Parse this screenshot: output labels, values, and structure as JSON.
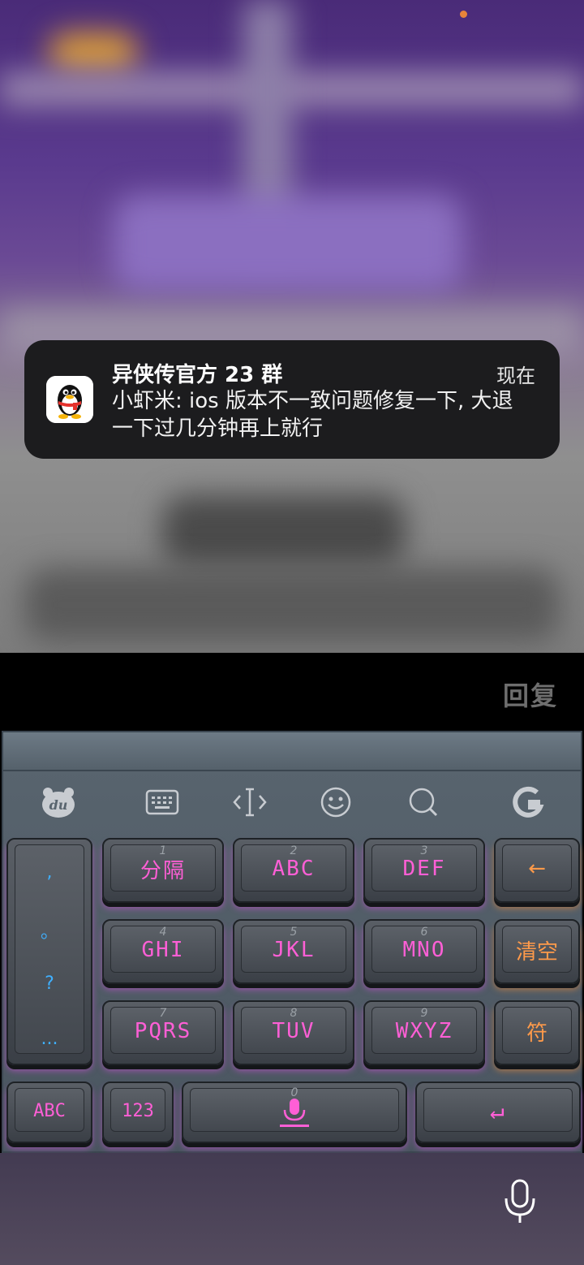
{
  "notification": {
    "title": "异侠传官方 23 群",
    "time": "现在",
    "message": "小虾米: ios 版本不一致问题修复一下, 大退一下过几分钟再上就行",
    "app_icon": "qq-penguin-icon"
  },
  "reply": {
    "label": "回复"
  },
  "toolbar": {
    "items": [
      {
        "name": "du-logo-icon"
      },
      {
        "name": "keyboard-icon"
      },
      {
        "name": "cursor-move-icon"
      },
      {
        "name": "emoji-icon"
      },
      {
        "name": "search-icon"
      },
      {
        "name": "g-logo-icon"
      }
    ]
  },
  "keys": {
    "punctuation": [
      ",",
      "。",
      "?",
      "..."
    ],
    "row1": [
      {
        "num": "1",
        "label": "分隔"
      },
      {
        "num": "2",
        "label": "ABC"
      },
      {
        "num": "3",
        "label": "DEF"
      }
    ],
    "row2": [
      {
        "num": "4",
        "label": "GHI"
      },
      {
        "num": "5",
        "label": "JKL"
      },
      {
        "num": "6",
        "label": "MNO"
      }
    ],
    "row3": [
      {
        "num": "7",
        "label": "PQRS"
      },
      {
        "num": "8",
        "label": "TUV"
      },
      {
        "num": "9",
        "label": "WXYZ"
      }
    ],
    "backspace": "←",
    "clear": "清空",
    "symbols": "符",
    "abc": "ABC",
    "num123": "123",
    "space_num": "0",
    "enter": "↵"
  },
  "colors": {
    "key_label": "#ff5fd6",
    "function_key_label": "#ff9a4a",
    "punctuation": "#3fb0ff",
    "notification_bg": "#1c1c1e"
  }
}
